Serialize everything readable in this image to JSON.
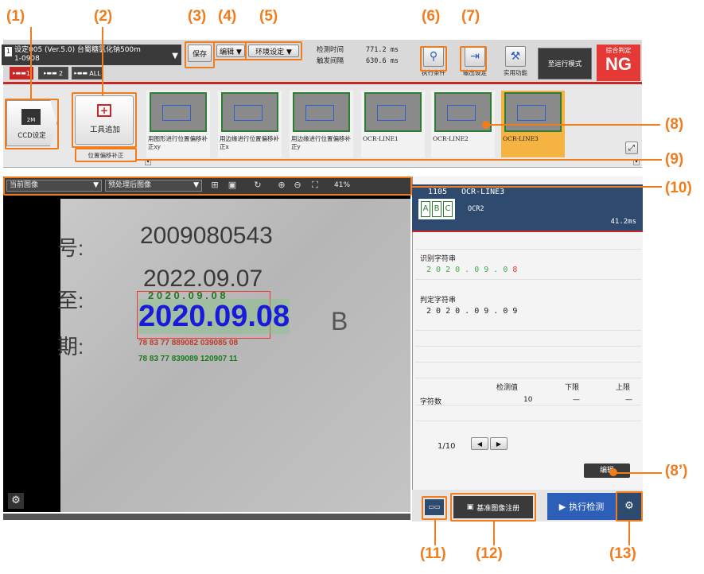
{
  "callouts": {
    "c1": "(1)",
    "c2": "(2)",
    "c3": "(3)",
    "c4": "(4)",
    "c5": "(5)",
    "c6": "(6)",
    "c7": "(7)",
    "c8": "(8)",
    "c8p": "(8’)",
    "c9": "(9)",
    "c10": "(10)",
    "c11": "(11)",
    "c12": "(12)",
    "c13": "(13)"
  },
  "header": {
    "setting_title": "设定005 (Ver.5.0) 台蜀糖氯化钠500m",
    "setting_sub": "1-0908",
    "save_label": "保存",
    "edit_label": "编辑 ▼",
    "env_label": "环境设定 ▼",
    "detect_time_label": "检测时间",
    "detect_time_value": "771.2 ms",
    "trigger_interval_label": "触发间隔",
    "trigger_interval_value": "630.6 ms",
    "exec_cond_label": "执行条件",
    "output_label": "输出设定",
    "util_label": "实用功能",
    "run_mode_label": "至运行模式",
    "judge_label": "综合判定",
    "judge_value": "NG",
    "tabs": [
      "1",
      "2",
      "ALL"
    ]
  },
  "toolbar_area": {
    "ccd_label": "CCD设定",
    "ccd_badge": "2M",
    "add_tool_label": "工具追加",
    "pos_comp_label": "位置偏移补正",
    "tools": [
      {
        "label": "用图形进行位置偏移补正xy"
      },
      {
        "label": "用边缘进行位置偏移补正x"
      },
      {
        "label": "用边缘进行位置偏移补正y"
      },
      {
        "label": "OCR-LINE1"
      },
      {
        "label": "OCR-LINE2"
      },
      {
        "label": "OCR-LINE3"
      }
    ]
  },
  "image_toolbar": {
    "current_image": "当前图像",
    "processed_image": "预处理后图像",
    "zoom": "41%"
  },
  "image": {
    "line1": "号:",
    "num1": "2009080543",
    "num2": "2022.09.07",
    "line2": "至:",
    "ocr_top": "2 0 2 0 . 0 9 . 0 8",
    "ocr_main": "2020.09.08",
    "line3": "期:",
    "small1": "78 83 77 889082 039085 08",
    "small2": "78 83 77 839089 120907 11",
    "letter": "B"
  },
  "result_panel": {
    "tool_id": "1105",
    "tool_name": "OCR-LINE3",
    "sub_name": "OCR2",
    "time": "41.2ms",
    "abc": [
      "A",
      "B",
      "C"
    ],
    "recognized_label": "识别字符串",
    "recognized_ok": "2 0 2 0 . 0 9 . 0 ",
    "recognized_ng": "8",
    "judge_label": "判定字符串",
    "judge_value": "2 0 2 0 . 0 9 . 0 9",
    "table_headers": [
      "检测值",
      "下限",
      "上限"
    ],
    "row_label": "字符数",
    "row_value": "10",
    "row_lower": "—",
    "row_upper": "—",
    "page": "1/10",
    "edit_button": "编辑"
  },
  "bottom": {
    "register_label": "基准图像注册",
    "run_label": "执行检测"
  },
  "colors": {
    "accent": "#f07c1c",
    "ng": "#e53935",
    "header_blue": "#2e4a6e",
    "selected_tool": "#f5b342"
  }
}
